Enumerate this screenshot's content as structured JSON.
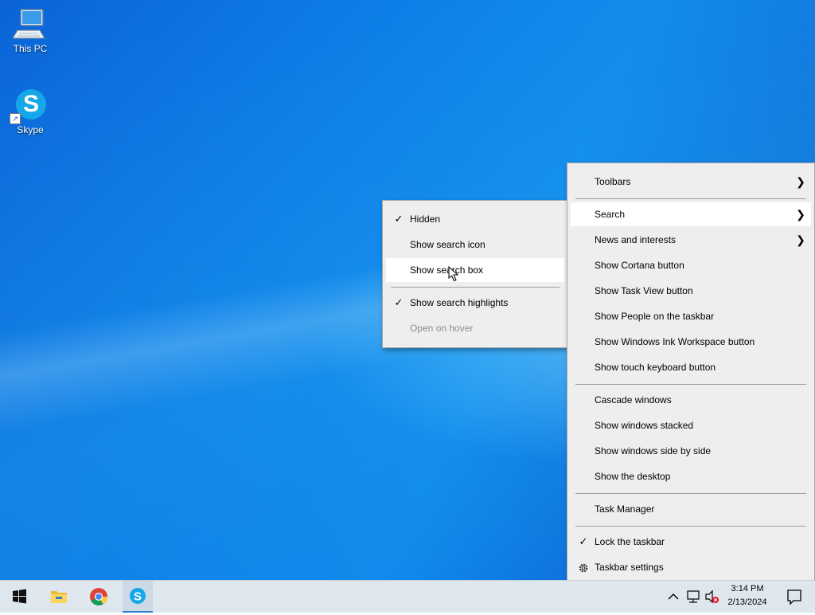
{
  "desktop": {
    "icons": [
      {
        "label": "This PC",
        "icon": "computer-icon"
      },
      {
        "label": "Skype",
        "icon": "skype-icon"
      }
    ]
  },
  "search_submenu": {
    "items": [
      {
        "label": "Hidden",
        "checked": true
      },
      {
        "label": "Show search icon"
      },
      {
        "label": "Show search box",
        "highlighted": true
      },
      {
        "label": "Show search highlights",
        "checked": true
      },
      {
        "label": "Open on hover",
        "disabled": true
      }
    ]
  },
  "context_menu": {
    "items": [
      {
        "label": "Toolbars",
        "submenu": true
      },
      {
        "label": "Search",
        "submenu": true,
        "highlighted": true
      },
      {
        "label": "News and interests",
        "submenu": true
      },
      {
        "label": "Show Cortana button"
      },
      {
        "label": "Show Task View button"
      },
      {
        "label": "Show People on the taskbar"
      },
      {
        "label": "Show Windows Ink Workspace button"
      },
      {
        "label": "Show touch keyboard button"
      },
      {
        "label": "Cascade windows"
      },
      {
        "label": "Show windows stacked"
      },
      {
        "label": "Show windows side by side"
      },
      {
        "label": "Show the desktop"
      },
      {
        "label": "Task Manager"
      },
      {
        "label": "Lock the taskbar",
        "checked": true
      },
      {
        "label": "Taskbar settings",
        "icon": "gear-icon"
      }
    ]
  },
  "taskbar": {
    "pinned": [
      "start-icon",
      "file-explorer-icon",
      "chrome-icon",
      "skype-icon"
    ],
    "tray_icons": [
      "chevron-up-icon",
      "network-icon",
      "volume-muted-icon",
      "notification-icon"
    ],
    "clock": {
      "time": "3:14 PM",
      "date": "2/13/2024"
    }
  },
  "colors": {
    "menu_bg": "#eeeeee",
    "menu_highlight": "#ffffff",
    "taskbar_bg": "#dfe7ee",
    "skype_blue": "#15a8e8"
  }
}
